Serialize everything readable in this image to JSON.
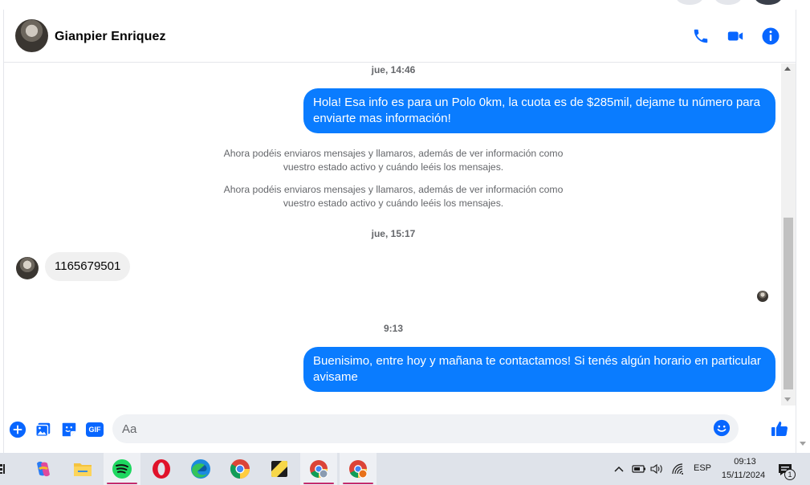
{
  "header": {
    "contact_name": "Gianpier Enriquez"
  },
  "messages": {
    "timestamp_1": "jue, 14:46",
    "outgoing_1": "Hola! Esa info es para un Polo 0km, la cuota es de $285mil, dejame tu número para enviarte mas información!",
    "system_note_1": "Ahora podéis enviaros mensajes y llamaros, además de ver información como vuestro estado activo y cuándo leéis los mensajes.",
    "system_note_2": "Ahora podéis enviaros mensajes y llamaros, además de ver información como vuestro estado activo y cuándo leéis los mensajes.",
    "timestamp_2": "jue, 15:17",
    "incoming_1": "1165679501",
    "timestamp_3": "9:13",
    "outgoing_2": "Buenisimo, entre hoy y mañana te contactamos! Si tenés algún horario en particular avisame"
  },
  "composer": {
    "placeholder": "Aa",
    "gif_label": "GIF"
  },
  "taskbar": {
    "language": "ESP",
    "time": "09:13",
    "date": "15/11/2024",
    "notification_count": "1"
  },
  "colors": {
    "accent": "#0a7cff",
    "icon_blue": "#0866ff"
  }
}
